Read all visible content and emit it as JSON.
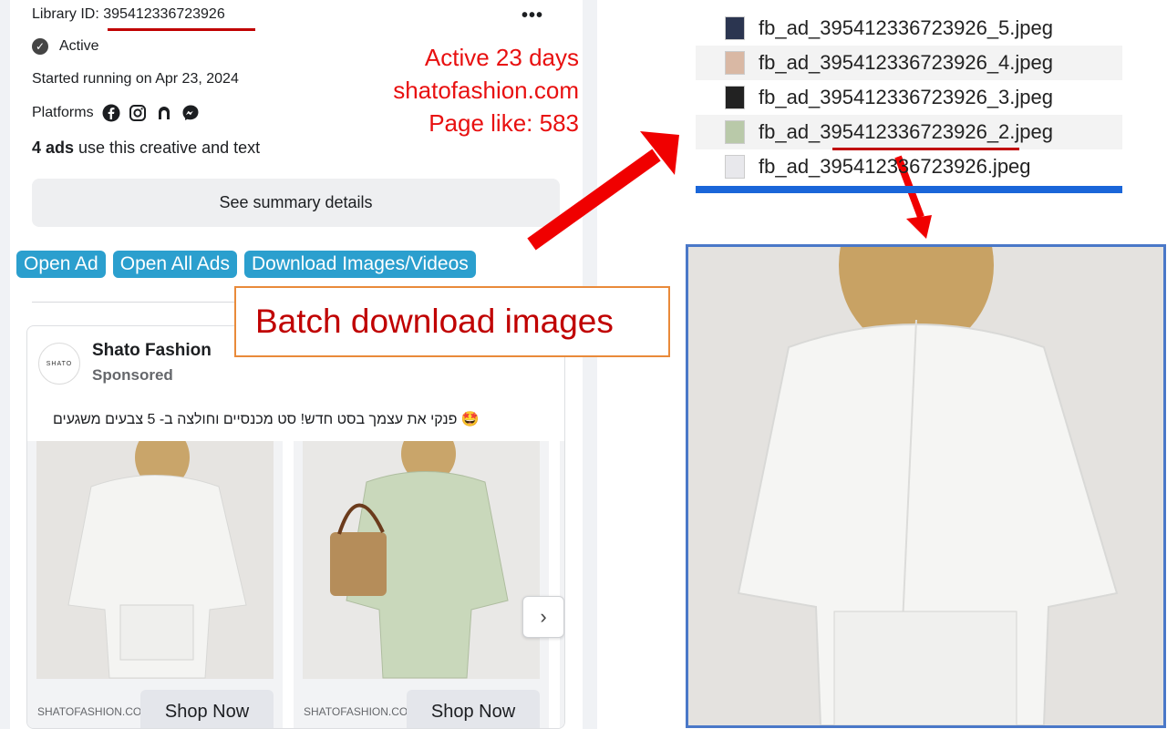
{
  "library": {
    "label": "Library ID: ",
    "id": "395412336723926",
    "more_glyph": "•••"
  },
  "status": {
    "check_glyph": "✓",
    "label": "Active"
  },
  "started": "Started running on Apr 23, 2024",
  "platforms": {
    "label": "Platforms",
    "icons": [
      "facebook-icon",
      "instagram-icon",
      "audience-network-icon",
      "messenger-icon"
    ]
  },
  "ads_count": {
    "count": "4 ads",
    "suffix": " use this creative and text"
  },
  "summary_button": "See summary details",
  "extension_buttons": {
    "open_ad": "Open Ad",
    "open_all": "Open All Ads",
    "download": "Download Images/Videos"
  },
  "annotation": {
    "active_days": "Active 23 days",
    "domain": "shatofashion.com",
    "page_like": "Page like: 583",
    "batch": "Batch download images"
  },
  "ad": {
    "page_name": "Shato Fashion",
    "avatar_text": "SHATO",
    "sponsored": "Sponsored",
    "body": "🤩 פנקי את עצמך בסט חדש! סט מכנסיים וחולצה ב- 5 צבעים משגעים",
    "carousel": [
      {
        "domain": "SHATOFASHION.COI",
        "cta": "Shop Now",
        "outfit_color": "#f4f4f2"
      },
      {
        "domain": "SHATOFASHION.COI",
        "cta": "Shop Now",
        "outfit_color": "#c9d8bb"
      }
    ],
    "next_glyph": "›"
  },
  "files": [
    {
      "name": "fb_ad_395412336723926_5.jpeg",
      "thumb": "#2b3550"
    },
    {
      "name": "fb_ad_395412336723926_4.jpeg",
      "thumb": "#d9b8a4"
    },
    {
      "name": "fb_ad_395412336723926_3.jpeg",
      "thumb": "#222222"
    },
    {
      "name": "fb_ad_395412336723926_2.jpeg",
      "thumb": "#b9c9a9"
    },
    {
      "name": "fb_ad_395412336723926.jpeg",
      "thumb": "#e8e8ec"
    }
  ],
  "colors": {
    "annotation_red": "#e81010",
    "extension_blue": "#2b9fce",
    "frame_blue": "#4a78c8",
    "box_orange": "#e98a3a"
  }
}
